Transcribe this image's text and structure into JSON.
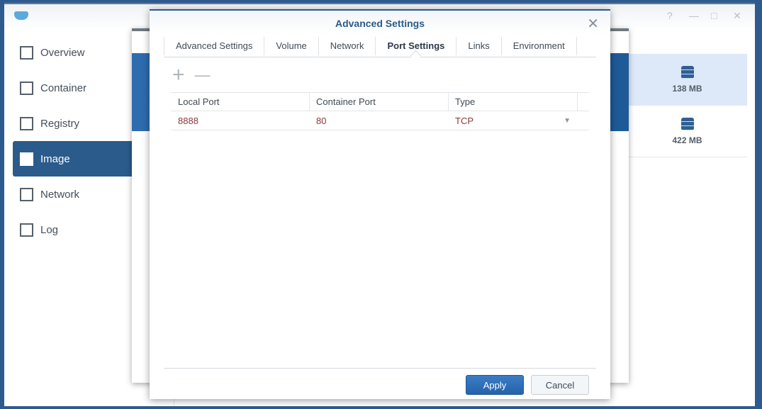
{
  "nav": [
    {
      "label": "Overview",
      "icon": "overview-icon"
    },
    {
      "label": "Container",
      "icon": "container-icon"
    },
    {
      "label": "Registry",
      "icon": "registry-icon"
    },
    {
      "label": "Image",
      "icon": "image-icon",
      "active": true
    },
    {
      "label": "Network",
      "icon": "network-icon"
    },
    {
      "label": "Log",
      "icon": "log-icon"
    }
  ],
  "images": [
    {
      "size": "138 MB"
    },
    {
      "size": "422 MB"
    }
  ],
  "window_controls": {
    "help": "?",
    "minimize": "—",
    "maximize": "□",
    "close": "✕"
  },
  "dialog": {
    "title": "Advanced Settings",
    "close": "✕",
    "tabs": [
      "Advanced Settings",
      "Volume",
      "Network",
      "Port Settings",
      "Links",
      "Environment"
    ],
    "active_tab": "Port Settings",
    "tools": {
      "add": "+",
      "remove": "—"
    },
    "columns": [
      "Local Port",
      "Container Port",
      "Type"
    ],
    "rows": [
      {
        "local": "8888",
        "container": "80",
        "type": "TCP"
      }
    ],
    "apply": "Apply",
    "cancel": "Cancel"
  },
  "colors": {
    "accent": "#2a5b8b",
    "desktop": "#2d5b90"
  }
}
